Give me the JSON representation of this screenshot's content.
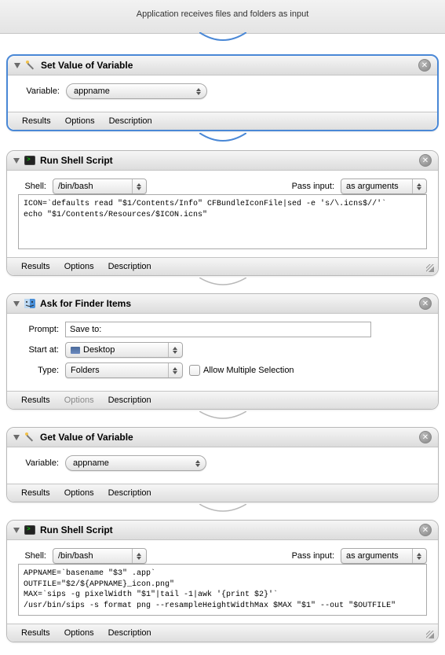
{
  "topbar": {
    "text": "Application receives files and folders as input"
  },
  "footer_tabs": {
    "results": "Results",
    "options": "Options",
    "description": "Description"
  },
  "actions": [
    {
      "title": "Set Value of Variable",
      "icon": "wand-icon",
      "body": {
        "variable_label": "Variable:",
        "variable_value": "appname"
      }
    },
    {
      "title": "Run Shell Script",
      "icon": "terminal-icon",
      "body": {
        "shell_label": "Shell:",
        "shell_value": "/bin/bash",
        "pass_label": "Pass input:",
        "pass_value": "as arguments",
        "script": "ICON=`defaults read \"$1/Contents/Info\" CFBundleIconFile|sed -e 's/\\.icns$//'`\necho \"$1/Contents/Resources/$ICON.icns\""
      }
    },
    {
      "title": "Ask for Finder Items",
      "icon": "finder-icon",
      "body": {
        "prompt_label": "Prompt:",
        "prompt_value": "Save to:",
        "start_label": "Start at:",
        "start_value": "Desktop",
        "type_label": "Type:",
        "type_value": "Folders",
        "allow_multi": "Allow Multiple Selection"
      }
    },
    {
      "title": "Get Value of Variable",
      "icon": "getvar-icon",
      "body": {
        "variable_label": "Variable:",
        "variable_value": "appname"
      }
    },
    {
      "title": "Run Shell Script",
      "icon": "terminal-icon",
      "body": {
        "shell_label": "Shell:",
        "shell_value": "/bin/bash",
        "pass_label": "Pass input:",
        "pass_value": "as arguments",
        "script": "APPNAME=`basename \"$3\" .app`\nOUTFILE=\"$2/${APPNAME}_icon.png\"\nMAX=`sips -g pixelWidth \"$1\"|tail -1|awk '{print $2}'`\n/usr/bin/sips -s format png --resampleHeightWidthMax $MAX \"$1\" --out \"$OUTFILE\""
      }
    }
  ]
}
